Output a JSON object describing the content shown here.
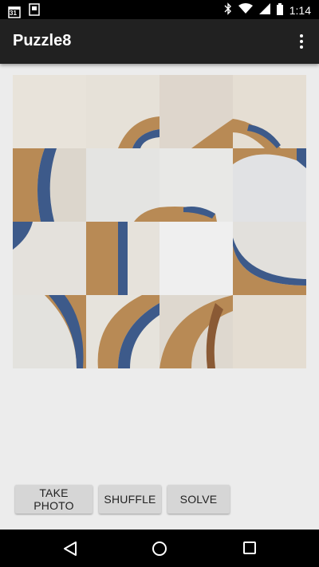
{
  "status_bar": {
    "time": "1:14",
    "calendar_day": "31",
    "icons": [
      "calendar-icon",
      "photo-icon",
      "bluetooth-icon",
      "wifi-icon",
      "signal-icon",
      "battery-icon"
    ]
  },
  "app_bar": {
    "title": "Puzzle8",
    "overflow_icon": "more-vert-icon"
  },
  "puzzle": {
    "grid_size": 4,
    "empty_tile": {
      "row": 2,
      "col": 2
    }
  },
  "buttons": {
    "take_photo": "TAKE PHOTO",
    "shuffle": "SHUFFLE",
    "solve": "SOLVE"
  },
  "nav_bar": {
    "icons": [
      "back-icon",
      "home-icon",
      "recents-icon"
    ]
  },
  "colors": {
    "wood": "#b88a55",
    "blue_edge": "#3d5a8a",
    "background": "#e6e1d9"
  }
}
